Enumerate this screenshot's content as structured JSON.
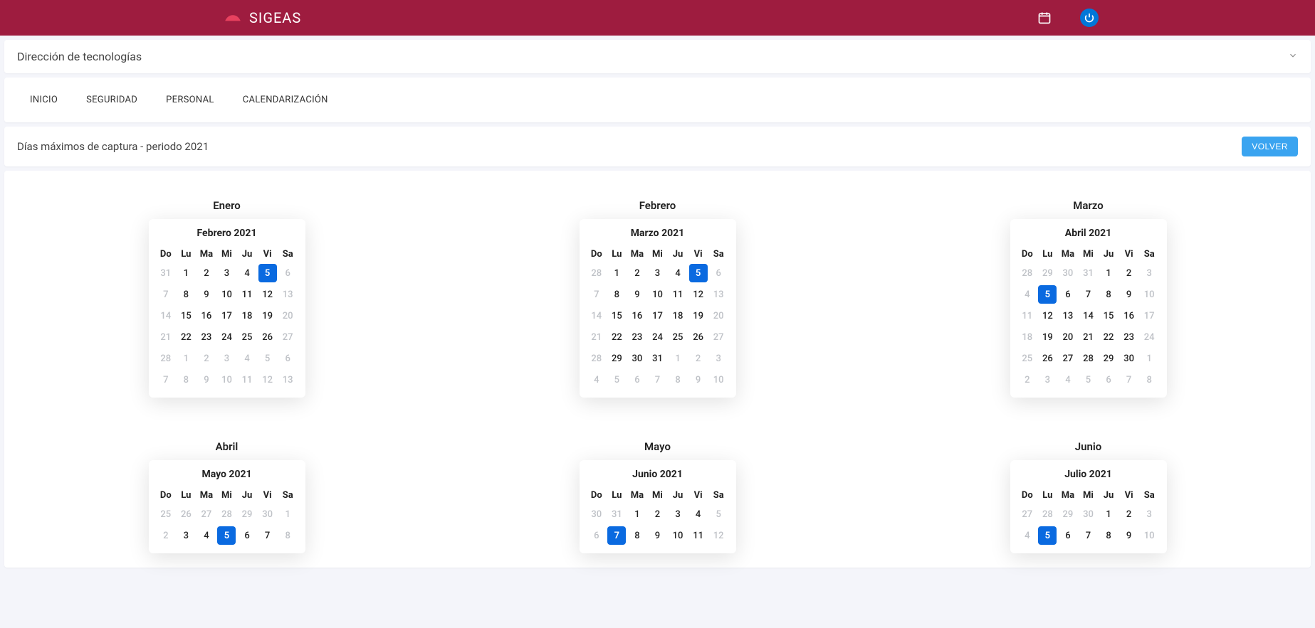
{
  "app": {
    "name": "SIGEAS"
  },
  "org_selector": {
    "value": "Dirección de tecnologías"
  },
  "tabs": [
    {
      "label": "INICIO"
    },
    {
      "label": "SEGURIDAD"
    },
    {
      "label": "PERSONAL"
    },
    {
      "label": "CALENDARIZACIÓN"
    }
  ],
  "page": {
    "title": "Días máximos de captura - periodo 2021",
    "back_label": "VOLVER"
  },
  "weekday_headers": [
    "Do",
    "Lu",
    "Ma",
    "Mi",
    "Ju",
    "Vi",
    "Sa"
  ],
  "calendars": [
    {
      "outer_label": "Enero",
      "inner_title": "Febrero 2021",
      "rows": [
        [
          {
            "d": "31",
            "muted": true
          },
          {
            "d": "1"
          },
          {
            "d": "2"
          },
          {
            "d": "3"
          },
          {
            "d": "4"
          },
          {
            "d": "5",
            "sel": true
          },
          {
            "d": "6",
            "muted": true
          }
        ],
        [
          {
            "d": "7",
            "muted": true
          },
          {
            "d": "8"
          },
          {
            "d": "9"
          },
          {
            "d": "10"
          },
          {
            "d": "11"
          },
          {
            "d": "12"
          },
          {
            "d": "13",
            "muted": true
          }
        ],
        [
          {
            "d": "14",
            "muted": true
          },
          {
            "d": "15"
          },
          {
            "d": "16"
          },
          {
            "d": "17"
          },
          {
            "d": "18"
          },
          {
            "d": "19"
          },
          {
            "d": "20",
            "muted": true
          }
        ],
        [
          {
            "d": "21",
            "muted": true
          },
          {
            "d": "22"
          },
          {
            "d": "23"
          },
          {
            "d": "24"
          },
          {
            "d": "25"
          },
          {
            "d": "26"
          },
          {
            "d": "27",
            "muted": true
          }
        ],
        [
          {
            "d": "28",
            "muted": true
          },
          {
            "d": "1",
            "muted": true
          },
          {
            "d": "2",
            "muted": true
          },
          {
            "d": "3",
            "muted": true
          },
          {
            "d": "4",
            "muted": true
          },
          {
            "d": "5",
            "muted": true
          },
          {
            "d": "6",
            "muted": true
          }
        ],
        [
          {
            "d": "7",
            "muted": true
          },
          {
            "d": "8",
            "muted": true
          },
          {
            "d": "9",
            "muted": true
          },
          {
            "d": "10",
            "muted": true
          },
          {
            "d": "11",
            "muted": true
          },
          {
            "d": "12",
            "muted": true
          },
          {
            "d": "13",
            "muted": true
          }
        ]
      ]
    },
    {
      "outer_label": "Febrero",
      "inner_title": "Marzo 2021",
      "rows": [
        [
          {
            "d": "28",
            "muted": true
          },
          {
            "d": "1"
          },
          {
            "d": "2"
          },
          {
            "d": "3"
          },
          {
            "d": "4"
          },
          {
            "d": "5",
            "sel": true
          },
          {
            "d": "6",
            "muted": true
          }
        ],
        [
          {
            "d": "7",
            "muted": true
          },
          {
            "d": "8"
          },
          {
            "d": "9"
          },
          {
            "d": "10"
          },
          {
            "d": "11"
          },
          {
            "d": "12"
          },
          {
            "d": "13",
            "muted": true
          }
        ],
        [
          {
            "d": "14",
            "muted": true
          },
          {
            "d": "15"
          },
          {
            "d": "16"
          },
          {
            "d": "17"
          },
          {
            "d": "18"
          },
          {
            "d": "19"
          },
          {
            "d": "20",
            "muted": true
          }
        ],
        [
          {
            "d": "21",
            "muted": true
          },
          {
            "d": "22"
          },
          {
            "d": "23"
          },
          {
            "d": "24"
          },
          {
            "d": "25"
          },
          {
            "d": "26"
          },
          {
            "d": "27",
            "muted": true
          }
        ],
        [
          {
            "d": "28",
            "muted": true
          },
          {
            "d": "29"
          },
          {
            "d": "30"
          },
          {
            "d": "31"
          },
          {
            "d": "1",
            "muted": true
          },
          {
            "d": "2",
            "muted": true
          },
          {
            "d": "3",
            "muted": true
          }
        ],
        [
          {
            "d": "4",
            "muted": true
          },
          {
            "d": "5",
            "muted": true
          },
          {
            "d": "6",
            "muted": true
          },
          {
            "d": "7",
            "muted": true
          },
          {
            "d": "8",
            "muted": true
          },
          {
            "d": "9",
            "muted": true
          },
          {
            "d": "10",
            "muted": true
          }
        ]
      ]
    },
    {
      "outer_label": "Marzo",
      "inner_title": "Abril 2021",
      "rows": [
        [
          {
            "d": "28",
            "muted": true
          },
          {
            "d": "29",
            "muted": true
          },
          {
            "d": "30",
            "muted": true
          },
          {
            "d": "31",
            "muted": true
          },
          {
            "d": "1"
          },
          {
            "d": "2"
          },
          {
            "d": "3",
            "muted": true
          }
        ],
        [
          {
            "d": "4",
            "muted": true
          },
          {
            "d": "5",
            "sel": true
          },
          {
            "d": "6"
          },
          {
            "d": "7"
          },
          {
            "d": "8"
          },
          {
            "d": "9"
          },
          {
            "d": "10",
            "muted": true
          }
        ],
        [
          {
            "d": "11",
            "muted": true
          },
          {
            "d": "12"
          },
          {
            "d": "13"
          },
          {
            "d": "14"
          },
          {
            "d": "15"
          },
          {
            "d": "16"
          },
          {
            "d": "17",
            "muted": true
          }
        ],
        [
          {
            "d": "18",
            "muted": true
          },
          {
            "d": "19"
          },
          {
            "d": "20"
          },
          {
            "d": "21"
          },
          {
            "d": "22"
          },
          {
            "d": "23"
          },
          {
            "d": "24",
            "muted": true
          }
        ],
        [
          {
            "d": "25",
            "muted": true
          },
          {
            "d": "26"
          },
          {
            "d": "27"
          },
          {
            "d": "28"
          },
          {
            "d": "29"
          },
          {
            "d": "30"
          },
          {
            "d": "1",
            "muted": true
          }
        ],
        [
          {
            "d": "2",
            "muted": true
          },
          {
            "d": "3",
            "muted": true
          },
          {
            "d": "4",
            "muted": true
          },
          {
            "d": "5",
            "muted": true
          },
          {
            "d": "6",
            "muted": true
          },
          {
            "d": "7",
            "muted": true
          },
          {
            "d": "8",
            "muted": true
          }
        ]
      ]
    },
    {
      "outer_label": "Abril",
      "inner_title": "Mayo 2021",
      "rows": [
        [
          {
            "d": "25",
            "muted": true
          },
          {
            "d": "26",
            "muted": true
          },
          {
            "d": "27",
            "muted": true
          },
          {
            "d": "28",
            "muted": true
          },
          {
            "d": "29",
            "muted": true
          },
          {
            "d": "30",
            "muted": true
          },
          {
            "d": "1",
            "muted": true
          }
        ],
        [
          {
            "d": "2",
            "muted": true
          },
          {
            "d": "3"
          },
          {
            "d": "4"
          },
          {
            "d": "5",
            "sel": true
          },
          {
            "d": "6"
          },
          {
            "d": "7"
          },
          {
            "d": "8",
            "muted": true
          }
        ]
      ]
    },
    {
      "outer_label": "Mayo",
      "inner_title": "Junio 2021",
      "rows": [
        [
          {
            "d": "30",
            "muted": true
          },
          {
            "d": "31",
            "muted": true
          },
          {
            "d": "1"
          },
          {
            "d": "2"
          },
          {
            "d": "3"
          },
          {
            "d": "4"
          },
          {
            "d": "5",
            "muted": true
          }
        ],
        [
          {
            "d": "6",
            "muted": true
          },
          {
            "d": "7",
            "sel": true
          },
          {
            "d": "8"
          },
          {
            "d": "9"
          },
          {
            "d": "10"
          },
          {
            "d": "11"
          },
          {
            "d": "12",
            "muted": true
          }
        ]
      ]
    },
    {
      "outer_label": "Junio",
      "inner_title": "Julio 2021",
      "rows": [
        [
          {
            "d": "27",
            "muted": true
          },
          {
            "d": "28",
            "muted": true
          },
          {
            "d": "29",
            "muted": true
          },
          {
            "d": "30",
            "muted": true
          },
          {
            "d": "1"
          },
          {
            "d": "2"
          },
          {
            "d": "3",
            "muted": true
          }
        ],
        [
          {
            "d": "4",
            "muted": true
          },
          {
            "d": "5",
            "sel": true
          },
          {
            "d": "6"
          },
          {
            "d": "7"
          },
          {
            "d": "8"
          },
          {
            "d": "9"
          },
          {
            "d": "10",
            "muted": true
          }
        ]
      ]
    }
  ]
}
